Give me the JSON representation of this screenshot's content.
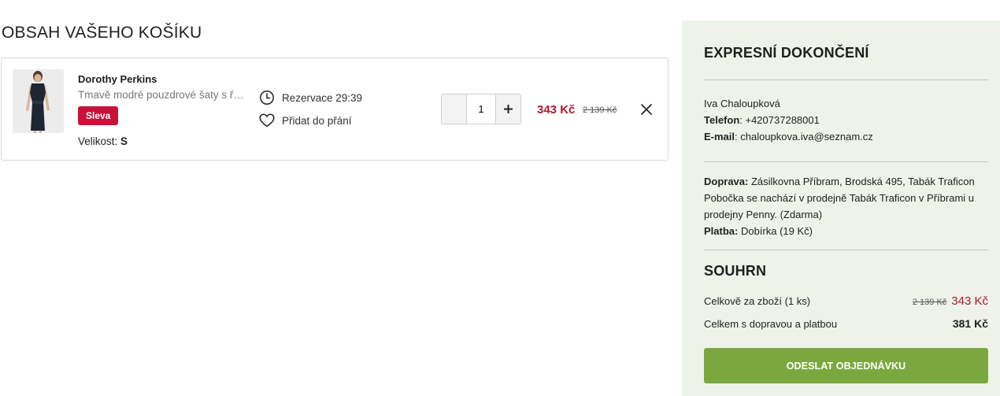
{
  "cart": {
    "title": "OBSAH VAŠEHO KOŠÍKU",
    "items": [
      {
        "brand": "Dorothy Perkins",
        "description": "Tmavě modré pouzdrové šaty s řasením",
        "badge": "Sleva",
        "size_label": "Velikost:",
        "size_value": "S",
        "reservation": "Rezervace 29:39",
        "wishlist": "Přidat do přání",
        "quantity": "1",
        "price_new": "343 Kč",
        "price_old": "2 139 Kč"
      }
    ]
  },
  "express": {
    "title": "EXPRESNÍ DOKONČENÍ",
    "name": "Iva Chaloupková",
    "phone_label": "Telefon",
    "phone_value": ": +420737288001",
    "email_label": "E-mail",
    "email_value": ": chaloupkova.iva@seznam.cz",
    "shipping_label": "Doprava:",
    "shipping_value": " Zásilkovna Příbram, Brodská 495, Tabák Traficon Pobočka se nachází v prodejně Tabák Traficon v Příbrami u prodejny Penny. (Zdarma)",
    "payment_label": "Platba:",
    "payment_value": " Dobírka (19 Kč)"
  },
  "summary": {
    "title": "SOUHRN",
    "goods_label": "Celkově za zboží (1 ks)",
    "goods_old": "2 139 Kč",
    "goods_new": "343 Kč",
    "total_label": "Celkem s dopravou a platbou",
    "total_value": "381 Kč",
    "submit_label": "ODESLAT OBJEDNÁVKU"
  },
  "colors": {
    "sale_badge": "#c8123a",
    "price": "#b0182f",
    "submit": "#7aa83f",
    "sidebar_bg": "#eef3e9"
  },
  "icons": [
    "clock-icon",
    "heart-icon",
    "minus-icon",
    "plus-icon",
    "close-icon"
  ]
}
